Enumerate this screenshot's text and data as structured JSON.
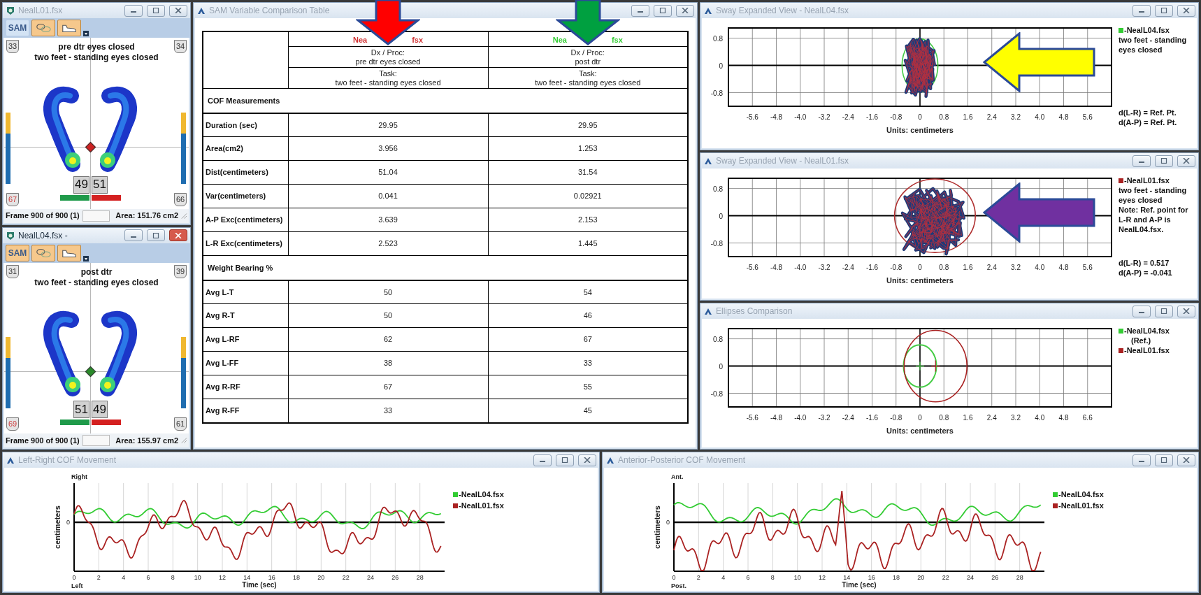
{
  "foot_windows": [
    {
      "title": "NealL01.fsx",
      "active": false,
      "toolbar": [
        {
          "kind": "text",
          "label": "SAM",
          "selected": false
        },
        {
          "kind": "loops",
          "selected": true
        },
        {
          "kind": "shoe",
          "selected": true
        }
      ],
      "heading": [
        "pre dtr eyes closed",
        "two feet - standing eyes closed"
      ],
      "corner_badges": [
        "33",
        "34",
        "67",
        "66"
      ],
      "weights": [
        "49",
        "51"
      ],
      "marker": {
        "color": "#cc2222"
      },
      "frame": "Frame 900 of 900 (1)",
      "area": "Area: 151.76 cm2"
    },
    {
      "title": "NealL04.fsx -",
      "active": true,
      "toolbar": [
        {
          "kind": "text",
          "label": "SAM",
          "selected": true
        },
        {
          "kind": "loops",
          "selected": true
        },
        {
          "kind": "shoe",
          "selected": true
        }
      ],
      "heading": [
        "post dtr",
        "two feet - standing eyes closed"
      ],
      "corner_badges": [
        "31",
        "39",
        "69",
        "61"
      ],
      "weights": [
        "51",
        "49"
      ],
      "marker": {
        "color": "#2a8a2a"
      },
      "frame": "Frame 900 of 900 (1)",
      "area": "Area: 155.97 cm2"
    }
  ],
  "comparison_window": {
    "title": "SAM Variable Comparison Table",
    "columns": [
      {
        "file_start": "Nea",
        "file_end": "fsx",
        "color": "#d03030",
        "dx_label": "Dx / Proc:",
        "dx": "pre dtr eyes closed",
        "task_label": "Task:",
        "task": "two feet - standing eyes closed",
        "arrow": {
          "color": "#ff0000"
        }
      },
      {
        "file_start": "Nea",
        "file_end": "fsx",
        "color": "#33cc33",
        "dx_label": "Dx / Proc:",
        "dx": "post dtr",
        "task_label": "Task:",
        "task": "two feet - standing eyes closed",
        "arrow": {
          "color": "#00a040"
        }
      }
    ],
    "sections": [
      {
        "title": "COF Measurements",
        "rows": [
          {
            "label": "Duration (sec)",
            "values": [
              "29.95",
              "29.95"
            ]
          },
          {
            "label": "Area(cm2)",
            "values": [
              "3.956",
              "1.253"
            ]
          },
          {
            "label": "Dist(centimeters)",
            "values": [
              "51.04",
              "31.54"
            ]
          },
          {
            "label": "Var(centimeters)",
            "values": [
              "0.041",
              "0.02921"
            ]
          },
          {
            "label": "A-P Exc(centimeters)",
            "values": [
              "3.639",
              "2.153"
            ]
          },
          {
            "label": "L-R Exc(centimeters)",
            "values": [
              "2.523",
              "1.445"
            ]
          }
        ]
      },
      {
        "title": "Weight Bearing %",
        "rows": [
          {
            "label": "Avg L-T",
            "values": [
              "50",
              "54"
            ]
          },
          {
            "label": "Avg R-T",
            "values": [
              "50",
              "46"
            ]
          },
          {
            "label": "Avg L-RF",
            "values": [
              "62",
              "67"
            ]
          },
          {
            "label": "Avg L-FF",
            "values": [
              "38",
              "33"
            ]
          },
          {
            "label": "Avg R-RF",
            "values": [
              "67",
              "55"
            ]
          },
          {
            "label": "Avg R-FF",
            "values": [
              "33",
              "45"
            ]
          }
        ]
      }
    ]
  },
  "sway_windows": [
    {
      "title": "Sway Expanded View - NealL04.fsx",
      "legend": {
        "label": "-NealL04.fsx",
        "color": "#33cc33"
      },
      "notes": [
        "two feet - standing",
        "eyes closed"
      ],
      "details": [
        "d(L-R) = Ref. Pt.",
        "d(A-P) = Ref. Pt."
      ],
      "yticks": [
        "0.8",
        "0",
        "-0.8"
      ],
      "xticks": [
        "-5.6",
        "-4.8",
        "-4.0",
        "-3.2",
        "-2.4",
        "-1.6",
        "-0.8",
        "0",
        "0.8",
        "1.6",
        "2.4",
        "3.2",
        "4.0",
        "4.8",
        "5.6"
      ],
      "xlabel": "Units: centimeters",
      "arrow": {
        "color": "#ffff00"
      }
    },
    {
      "title": "Sway Expanded View - NealL01.fsx",
      "legend": {
        "label": "-NealL01.fsx",
        "color": "#aa2222"
      },
      "notes": [
        "two feet - standing",
        "eyes closed",
        "Note: Ref. point for",
        "L-R and A-P is",
        "NealL04.fsx."
      ],
      "details": [
        "d(L-R) = 0.517",
        "d(A-P) = -0.041"
      ],
      "yticks": [
        "0.8",
        "0",
        "-0.8"
      ],
      "xticks": [
        "-5.6",
        "-4.8",
        "-4.0",
        "-3.2",
        "-2.4",
        "-1.6",
        "-0.8",
        "0",
        "0.8",
        "1.6",
        "2.4",
        "3.2",
        "4.0",
        "4.8",
        "5.6"
      ],
      "xlabel": "Units: centimeters",
      "arrow": {
        "color": "#7030a0"
      }
    }
  ],
  "ellipses_window": {
    "title": "Ellipses Comparison",
    "legend": [
      {
        "label": "-NealL04.fsx",
        "sub": "(Ref.)",
        "color": "#33cc33"
      },
      {
        "label": "-NealL01.fsx",
        "color": "#aa2222"
      }
    ],
    "yticks": [
      "0.8",
      "0",
      "-0.8"
    ],
    "xticks": [
      "-5.6",
      "-4.8",
      "-4.0",
      "-3.2",
      "-2.4",
      "-1.6",
      "-0.8",
      "0",
      "0.8",
      "1.6",
      "2.4",
      "3.2",
      "4.0",
      "4.8",
      "6.6"
    ],
    "xlabel": "Units: centimeters"
  },
  "movement_windows": [
    {
      "title": "Left-Right COF Movement",
      "top_label": "Right",
      "bottom_label": "Left",
      "ylabel": "centimeters",
      "ytick": "0",
      "xticks": [
        "0",
        "2",
        "4",
        "6",
        "8",
        "10",
        "12",
        "14",
        "16",
        "18",
        "20",
        "22",
        "24",
        "26",
        "28"
      ],
      "xlabel": "Time (sec)",
      "legend": [
        {
          "label": "-NealL04.fsx",
          "color": "#33cc33"
        },
        {
          "label": "-NealL01.fsx",
          "color": "#aa2222"
        }
      ]
    },
    {
      "title": "Anterior-Posterior COF Movement",
      "top_label": "Ant.",
      "bottom_label": "Post.",
      "ylabel": "centimeters",
      "ytick": "0",
      "xticks": [
        "0",
        "2",
        "4",
        "6",
        "8",
        "10",
        "12",
        "14",
        "16",
        "18",
        "20",
        "22",
        "24",
        "26",
        "28"
      ],
      "xlabel": "Time (sec)",
      "legend": [
        {
          "label": "-NealL04.fsx",
          "color": "#33cc33"
        },
        {
          "label": "-NealL01.fsx",
          "color": "#aa2222"
        }
      ]
    }
  ]
}
